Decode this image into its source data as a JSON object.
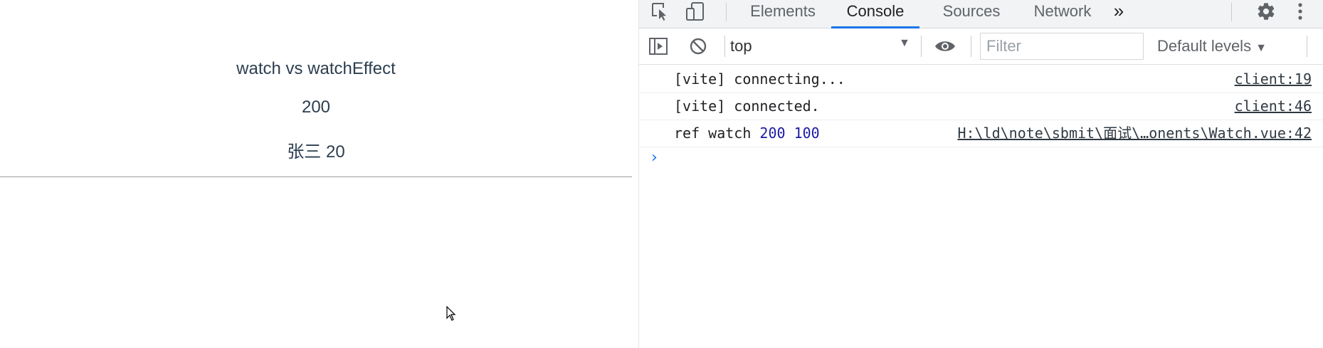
{
  "viewport": {
    "title": "watch vs watchEffect",
    "number": "200",
    "person": "张三 20"
  },
  "devtools": {
    "tabs": [
      {
        "label": "Elements"
      },
      {
        "label": "Console"
      },
      {
        "label": "Sources"
      },
      {
        "label": "Network"
      }
    ],
    "more_tabs_glyph": "»",
    "active_tab": "Console",
    "toolbar": {
      "context": "top",
      "filter_placeholder": "Filter",
      "levels": "Default levels"
    },
    "console": {
      "messages": [
        {
          "text": "[vite] connecting...",
          "source": "client:19"
        },
        {
          "text": "[vite] connected.",
          "source": "client:46"
        },
        {
          "prefix": "ref watch",
          "values": [
            "200",
            "100"
          ],
          "source": "H:\\ld\\note\\sbmit\\面试\\…onents\\Watch.vue:42"
        }
      ],
      "prompt_glyph": "›"
    }
  },
  "colors": {
    "active_tab_underline": "#1a73e8",
    "number_value": "#1a1aa6",
    "prompt": "#1a73e8",
    "vue_text": "#2c3e50"
  }
}
